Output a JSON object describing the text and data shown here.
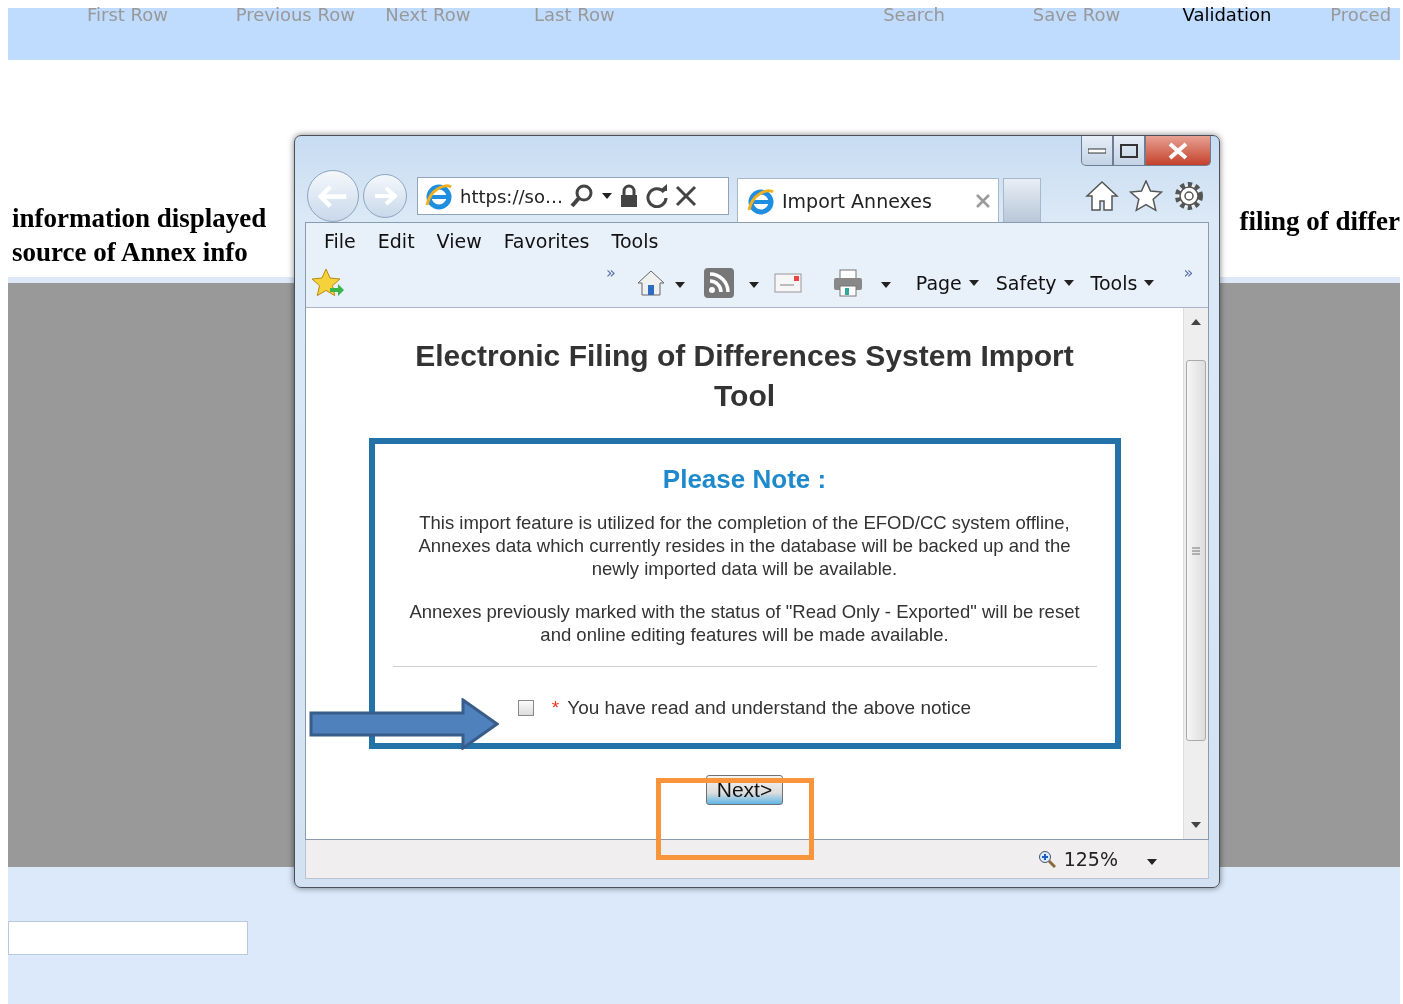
{
  "page_toolbar": [
    {
      "label": "First Row",
      "disabled": true
    },
    {
      "label": "Previous Row",
      "disabled": true
    },
    {
      "label": "Next Row",
      "disabled": true
    },
    {
      "label": "Last Row",
      "disabled": true
    },
    {
      "label": "Search",
      "disabled": true
    },
    {
      "label": "Save Row",
      "disabled": true
    },
    {
      "label": "Validation",
      "disabled": false
    },
    {
      "label": "Proced",
      "disabled": true
    }
  ],
  "page_text_left": [
    "information displayed",
    "source of Annex info"
  ],
  "page_text_right": [
    "filing of differ"
  ],
  "browser": {
    "address": "https://so…",
    "tab": {
      "title": "Import Annexes"
    },
    "menu": [
      "File",
      "Edit",
      "View",
      "Favorites",
      "Tools"
    ],
    "commands": [
      "Page",
      "Safety",
      "Tools"
    ],
    "chevrons": [
      "»",
      "»"
    ],
    "zoom": "125%"
  },
  "content": {
    "title": "Electronic Filing of Differences System Import Tool",
    "note_heading": "Please Note :",
    "paragraphs": [
      "This import feature is utilized for the completion of the EFOD/CC system offline, Annexes data which currently resides in the database will be backed up and the newly imported data will be available.",
      "Annexes previously marked with the status of \"Read Only - Exported\" will be reset and online editing features will be made available."
    ],
    "agreement": {
      "required_mark": "*",
      "label": "You have read and understand the above notice",
      "checked": false
    },
    "next_button": "Next>"
  }
}
